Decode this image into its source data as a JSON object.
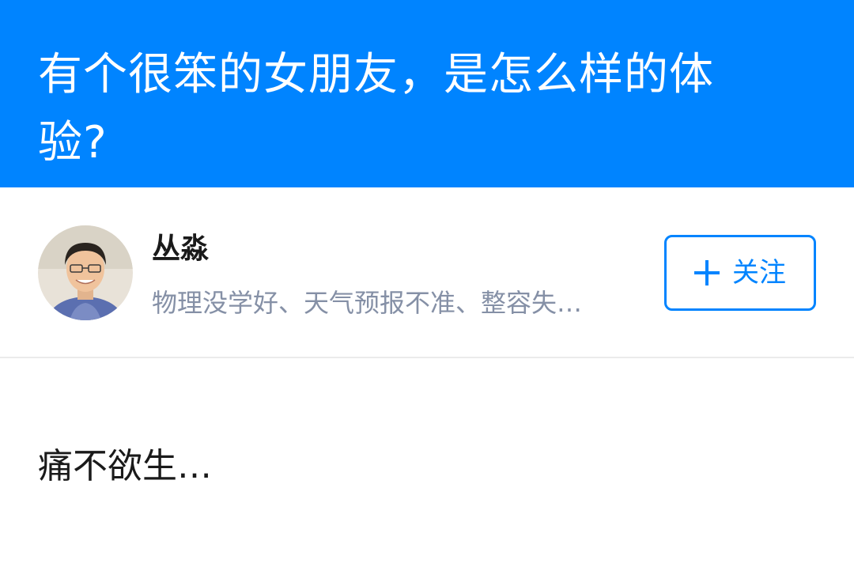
{
  "question": {
    "title": "有个很笨的女朋友，是怎么样的体验?"
  },
  "author": {
    "name": "丛淼",
    "bio": "物理没学好、天气预报不准、整容失…",
    "follow_label": "关注",
    "avatar_icon": "user-avatar"
  },
  "answer": {
    "text": "痛不欲生…"
  },
  "colors": {
    "brand": "#0084ff",
    "text_primary": "#1a1a1a",
    "text_secondary": "#8590a6"
  }
}
